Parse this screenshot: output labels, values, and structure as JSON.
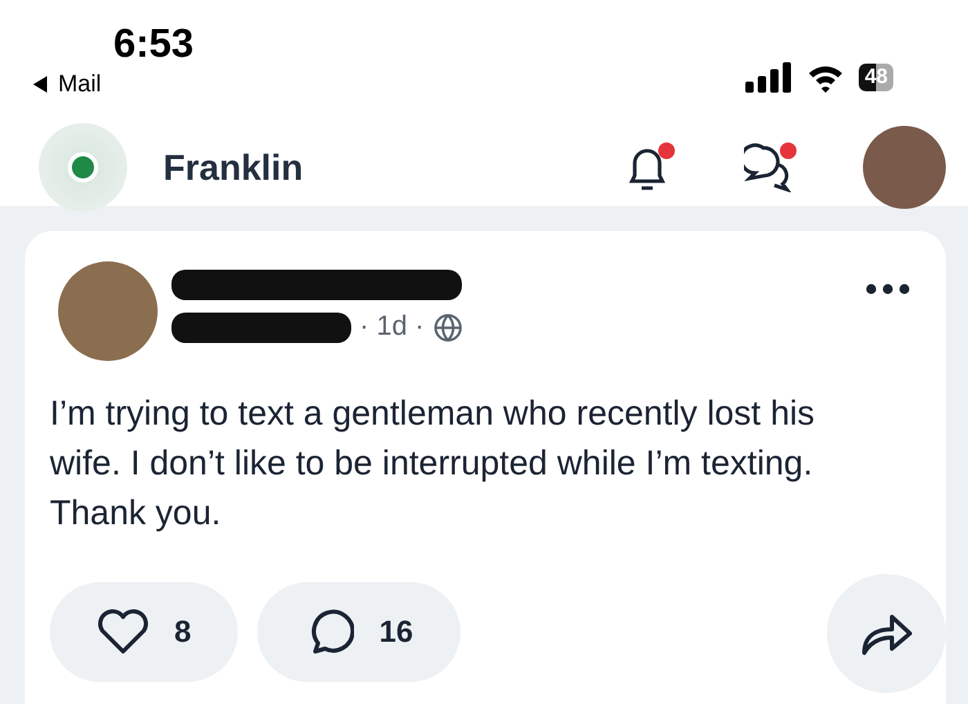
{
  "status_bar": {
    "time": "6:53",
    "back_link": "Mail",
    "battery": "48"
  },
  "header": {
    "community": "Franklin",
    "notifications_unread": true,
    "messages_unread": true
  },
  "post": {
    "meta": "· 1d ·",
    "body": "I’m trying to text a gentleman who recently lost his wife. I don’t like to be interrupted while I’m texting. Thank you.",
    "likes": "8",
    "comments": "16"
  }
}
